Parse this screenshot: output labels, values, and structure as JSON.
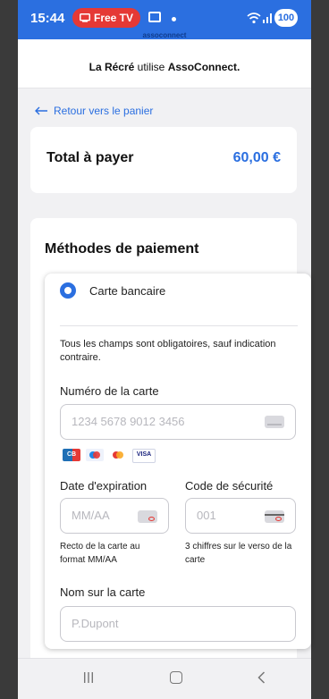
{
  "status_bar": {
    "time": "15:44",
    "tv_badge": "Free TV",
    "battery": "100"
  },
  "brand": {
    "small_text": "assoconnect"
  },
  "header": {
    "org_name": "La Récré",
    "middle_text": " utilise ",
    "platform_name": "AssoConnect."
  },
  "back_link": {
    "label": "Retour vers le panier"
  },
  "total": {
    "label": "Total à payer",
    "amount": "60,00 €"
  },
  "methods": {
    "title": "Méthodes de paiement",
    "selected_method": "Carte bancaire",
    "info": "Tous les champs sont obligatoires, sauf indication contraire."
  },
  "form": {
    "card_number": {
      "label": "Numéro de la carte",
      "placeholder": "1234 5678 9012 3456"
    },
    "card_brands": [
      "CB",
      "Maestro",
      "Mastercard",
      "VISA"
    ],
    "expiry": {
      "label": "Date d'expiration",
      "placeholder": "MM/AA",
      "help": "Recto de la carte au format MM/AA"
    },
    "cvc": {
      "label": "Code de sécurité",
      "placeholder": "001",
      "help": "3 chiffres sur le verso de la carte"
    },
    "name": {
      "label": "Nom sur la carte",
      "placeholder": "P.Dupont"
    }
  },
  "colors": {
    "accent": "#2b6fe0",
    "status_bar": "#2b6fe0",
    "badge_red": "#e53935"
  }
}
